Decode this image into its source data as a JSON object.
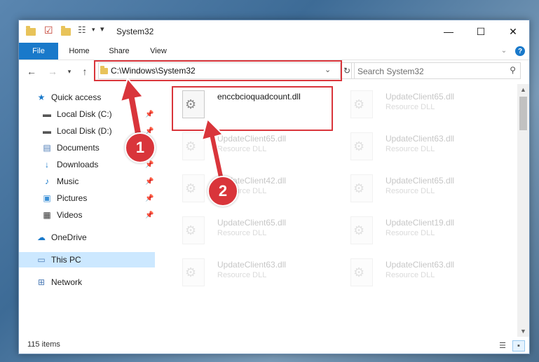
{
  "window": {
    "title": "System32",
    "controls": {
      "minimize": "—",
      "maximize": "☐",
      "close": "✕"
    }
  },
  "ribbon": {
    "tabs": [
      "File",
      "Home",
      "Share",
      "View"
    ],
    "collapse_icon": "chevron-down-icon",
    "help_icon": "?"
  },
  "address": {
    "path": "C:\\Windows\\System32",
    "search_placeholder": "Search System32"
  },
  "sidebar": {
    "items": [
      {
        "label": "Quick access",
        "icon": "star-icon",
        "pinned": false
      },
      {
        "label": "Local Disk (C:)",
        "icon": "drive-icon",
        "pinned": true
      },
      {
        "label": "Local Disk (D:)",
        "icon": "drive-icon",
        "pinned": true
      },
      {
        "label": "Documents",
        "icon": "documents-icon",
        "pinned": true
      },
      {
        "label": "Downloads",
        "icon": "downloads-icon",
        "pinned": true
      },
      {
        "label": "Music",
        "icon": "music-icon",
        "pinned": true
      },
      {
        "label": "Pictures",
        "icon": "pictures-icon",
        "pinned": true
      },
      {
        "label": "Videos",
        "icon": "videos-icon",
        "pinned": true
      },
      {
        "label": "OneDrive",
        "icon": "cloud-icon",
        "pinned": false
      },
      {
        "label": "This PC",
        "icon": "computer-icon",
        "pinned": false,
        "selected": true
      },
      {
        "label": "Network",
        "icon": "network-icon",
        "pinned": false
      }
    ]
  },
  "files": [
    {
      "name": "enccbcioquadcount.dll",
      "type": "",
      "highlighted": true
    },
    {
      "name": "UpdateClient65.dll",
      "type": "Resource DLL"
    },
    {
      "name": "UpdateClient65.dll",
      "type": "Resource DLL"
    },
    {
      "name": "UpdateClient63.dll",
      "type": "Resource DLL"
    },
    {
      "name": "UpdateClient42.dll",
      "type": "Resource DLL"
    },
    {
      "name": "UpdateClient65.dll",
      "type": "Resource DLL"
    },
    {
      "name": "UpdateClient65.dll",
      "type": "Resource DLL"
    },
    {
      "name": "UpdateClient19.dll",
      "type": "Resource DLL"
    },
    {
      "name": "UpdateClient63.dll",
      "type": "Resource DLL"
    },
    {
      "name": "UpdateClient63.dll",
      "type": "Resource DLL"
    }
  ],
  "status": {
    "item_count": "115 items"
  },
  "annotations": {
    "step1": "1",
    "step2": "2",
    "color": "#d9353b"
  }
}
